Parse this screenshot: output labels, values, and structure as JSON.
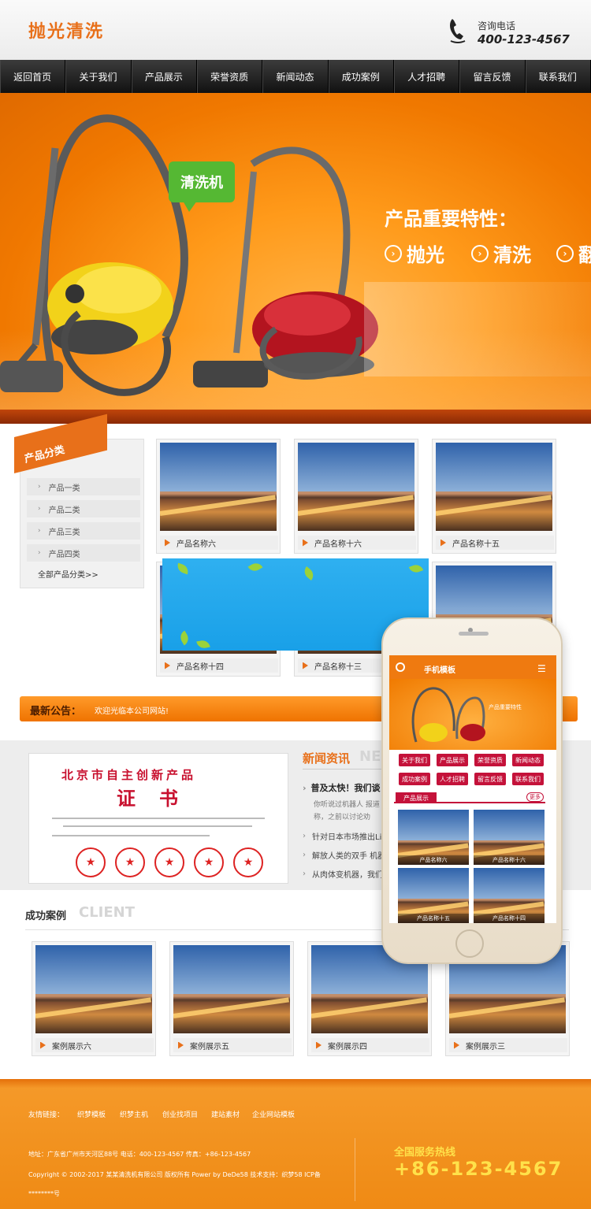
{
  "header": {
    "logo": "抛光清洗",
    "phone_label": "咨询电话",
    "phone_number": "400-123-4567"
  },
  "nav": [
    "返回首页",
    "关于我们",
    "产品展示",
    "荣誉资质",
    "新闻动态",
    "成功案例",
    "人才招聘",
    "留言反馈",
    "联系我们"
  ],
  "banner": {
    "bubble": "清洗机",
    "feature_title": "产品重要特性：",
    "features": [
      "抛光",
      "清洗",
      "翻"
    ]
  },
  "sidebar": {
    "title": "产品分类",
    "categories": [
      "产品一类",
      "产品二类",
      "产品三类",
      "产品四类"
    ],
    "all_link": "全部产品分类>>"
  },
  "products": [
    {
      "name": "产品名称六"
    },
    {
      "name": "产品名称十六"
    },
    {
      "name": "产品名称十五"
    },
    {
      "name": "产品名称十四"
    },
    {
      "name": "产品名称十三"
    },
    {
      "name": ""
    }
  ],
  "notice": {
    "label": "最新公告：",
    "text": "欢迎光临本公司网站!"
  },
  "certificate": {
    "line1": "北京市自主创新产品",
    "line2": "证书"
  },
  "news": {
    "title": "新闻资讯",
    "title_en": "NE",
    "headline": "普及太快！我们谈",
    "snippet": "你听说过机器人 报道称，之前以讨论劝",
    "items": [
      "针对日本市场推出Lin",
      "解放人类的双手 机器",
      "从肉体变机器，我们还"
    ]
  },
  "cases": {
    "title": "成功案例",
    "title_en": "CLIENT",
    "items": [
      "案例展示六",
      "案例展示五",
      "案例展示四",
      "案例展示三"
    ]
  },
  "footer": {
    "links_label": "友情链接：",
    "links": [
      "织梦模板",
      "织梦主机",
      "创业找项目",
      "建站素材",
      "企业网站模板"
    ],
    "address": "地址：广东省广州市天河区88号  电话：400-123-4567  传真：+86-123-4567",
    "copyright": "Copyright © 2002-2017 某某清洗机有限公司 版权所有 Power by DeDe58  技术支持：织梦58  ICP备",
    "icp": "********号",
    "hotline_label": "全国服务热线",
    "hotline_number": "+86-123-4567"
  },
  "mobile": {
    "title": "手机模板",
    "banner_text": "产品重要特性",
    "buttons": [
      "关于我们",
      "产品展示",
      "荣誉资质",
      "新闻动态",
      "成功案例",
      "人才招聘",
      "留言反馈",
      "联系我们"
    ],
    "products_title": "产品展示",
    "more": "更多",
    "products": [
      "产品名称六",
      "产品名称十六",
      "产品名称十五",
      "产品名称十四"
    ]
  }
}
